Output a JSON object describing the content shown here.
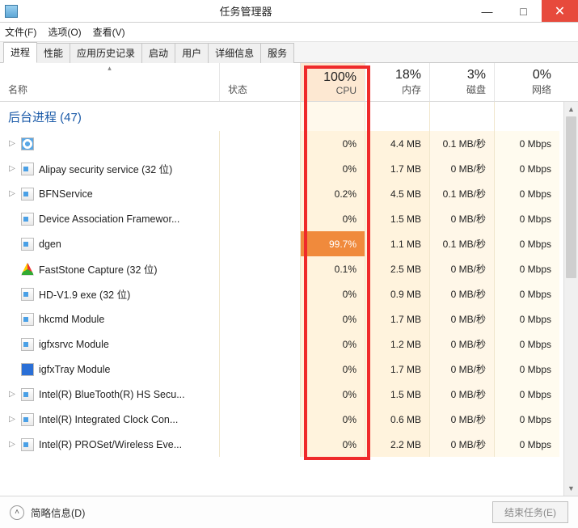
{
  "window": {
    "title": "任务管理器"
  },
  "menu": {
    "file": "文件(F)",
    "options": "选项(O)",
    "view": "查看(V)"
  },
  "tabs": [
    {
      "label": "进程",
      "active": true
    },
    {
      "label": "性能"
    },
    {
      "label": "应用历史记录"
    },
    {
      "label": "启动"
    },
    {
      "label": "用户"
    },
    {
      "label": "详细信息"
    },
    {
      "label": "服务"
    }
  ],
  "columns": {
    "name": "名称",
    "status": "状态",
    "cpu": {
      "pct": "100%",
      "label": "CPU"
    },
    "mem": {
      "pct": "18%",
      "label": "内存"
    },
    "disk": {
      "pct": "3%",
      "label": "磁盘"
    },
    "net": {
      "pct": "0%",
      "label": "网络"
    }
  },
  "group": {
    "label": "后台进程 (47)"
  },
  "rows": [
    {
      "exp": "▷",
      "icon": "gear",
      "name": "",
      "cpu": "0%",
      "mem": "4.4 MB",
      "disk": "0.1 MB/秒",
      "net": "0 Mbps"
    },
    {
      "exp": "▷",
      "icon": "generic",
      "name": "Alipay security service (32 位)",
      "cpu": "0%",
      "mem": "1.7 MB",
      "disk": "0 MB/秒",
      "net": "0 Mbps"
    },
    {
      "exp": "▷",
      "icon": "generic",
      "name": "BFNService",
      "cpu": "0.2%",
      "mem": "4.5 MB",
      "disk": "0.1 MB/秒",
      "net": "0 Mbps"
    },
    {
      "exp": "",
      "icon": "generic",
      "name": "Device Association Framewor...",
      "cpu": "0%",
      "mem": "1.5 MB",
      "disk": "0 MB/秒",
      "net": "0 Mbps"
    },
    {
      "exp": "",
      "icon": "generic",
      "name": "dgen",
      "cpu": "99.7%",
      "mem": "1.1 MB",
      "disk": "0.1 MB/秒",
      "net": "0 Mbps",
      "hot": true
    },
    {
      "exp": "",
      "icon": "fast",
      "name": "FastStone Capture (32 位)",
      "cpu": "0.1%",
      "mem": "2.5 MB",
      "disk": "0 MB/秒",
      "net": "0 Mbps"
    },
    {
      "exp": "",
      "icon": "generic",
      "name": "HD-V1.9 exe (32 位)",
      "cpu": "0%",
      "mem": "0.9 MB",
      "disk": "0 MB/秒",
      "net": "0 Mbps"
    },
    {
      "exp": "",
      "icon": "generic",
      "name": "hkcmd Module",
      "cpu": "0%",
      "mem": "1.7 MB",
      "disk": "0 MB/秒",
      "net": "0 Mbps"
    },
    {
      "exp": "",
      "icon": "generic",
      "name": "igfxsrvc Module",
      "cpu": "0%",
      "mem": "1.2 MB",
      "disk": "0 MB/秒",
      "net": "0 Mbps"
    },
    {
      "exp": "",
      "icon": "tray",
      "name": "igfxTray Module",
      "cpu": "0%",
      "mem": "1.7 MB",
      "disk": "0 MB/秒",
      "net": "0 Mbps"
    },
    {
      "exp": "▷",
      "icon": "generic",
      "name": "Intel(R) BlueTooth(R) HS Secu...",
      "cpu": "0%",
      "mem": "1.5 MB",
      "disk": "0 MB/秒",
      "net": "0 Mbps"
    },
    {
      "exp": "▷",
      "icon": "generic",
      "name": "Intel(R) Integrated Clock Con...",
      "cpu": "0%",
      "mem": "0.6 MB",
      "disk": "0 MB/秒",
      "net": "0 Mbps"
    },
    {
      "exp": "▷",
      "icon": "generic",
      "name": "Intel(R) PROSet/Wireless Eve...",
      "cpu": "0%",
      "mem": "2.2 MB",
      "disk": "0 MB/秒",
      "net": "0 Mbps"
    }
  ],
  "footer": {
    "details": "简略信息(D)",
    "endtask": "结束任务(E)"
  }
}
